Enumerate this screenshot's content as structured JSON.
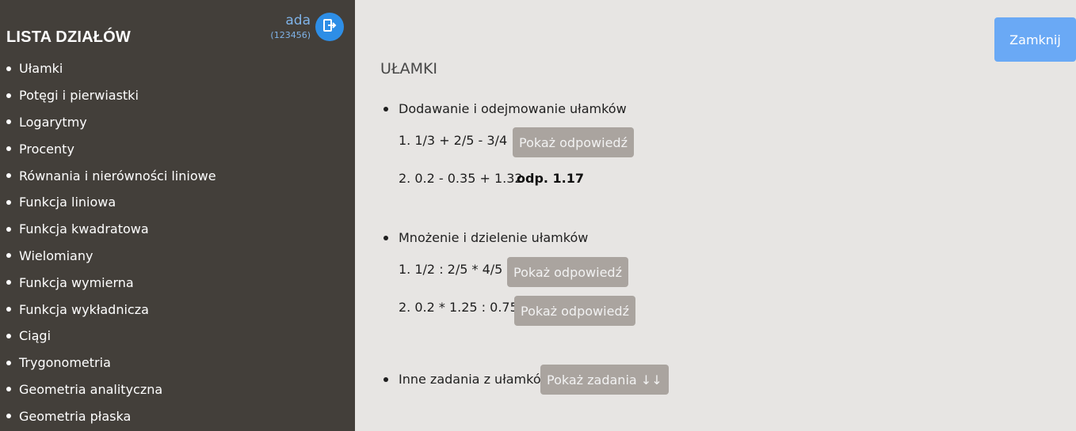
{
  "sidebar": {
    "title": "LISTA DZIAŁÓW",
    "user": {
      "name": "ada",
      "id": "(123456)"
    },
    "logout_icon": "logout-icon",
    "items": [
      "Ułamki",
      "Potęgi i pierwiastki",
      "Logarytmy",
      "Procenty",
      "Równania i nierówności liniowe",
      "Funkcja liniowa",
      "Funkcja kwadratowa",
      "Wielomiany",
      "Funkcja wymierna",
      "Funkcja wykładnicza",
      "Ciągi",
      "Trygonometria",
      "Geometria analityczna",
      "Geometria płaska"
    ]
  },
  "header": {
    "close_label": "Zamknij"
  },
  "main": {
    "title": "UŁAMKI",
    "sections": [
      {
        "heading": "Dodawanie i odejmowanie ułamków",
        "exercises": [
          {
            "text": "1. 1/3 + 2/5 - 3/4",
            "button": "Pokaż odpowiedź"
          },
          {
            "text": "2. 0.2 - 0.35 + 1.32",
            "answer": "odp. 1.17"
          }
        ]
      },
      {
        "heading": "Mnożenie i dzielenie ułamków",
        "exercises": [
          {
            "text": "1. 1/2 : 2/5 * 4/5",
            "button": "Pokaż odpowiedź"
          },
          {
            "text": "2. 0.2 * 1.25 : 0.75",
            "button": "Pokaż odpowiedź"
          }
        ]
      },
      {
        "heading": "Inne zadania z ułamków",
        "button": "Pokaż zadania ↓↓"
      }
    ]
  },
  "colors": {
    "sidebar_bg": "#433f3a",
    "main_bg": "#e7e5e3",
    "accent_blue": "#2e8ee6",
    "close_button": "#6aa9f5",
    "answer_button": "#aaa49f"
  }
}
